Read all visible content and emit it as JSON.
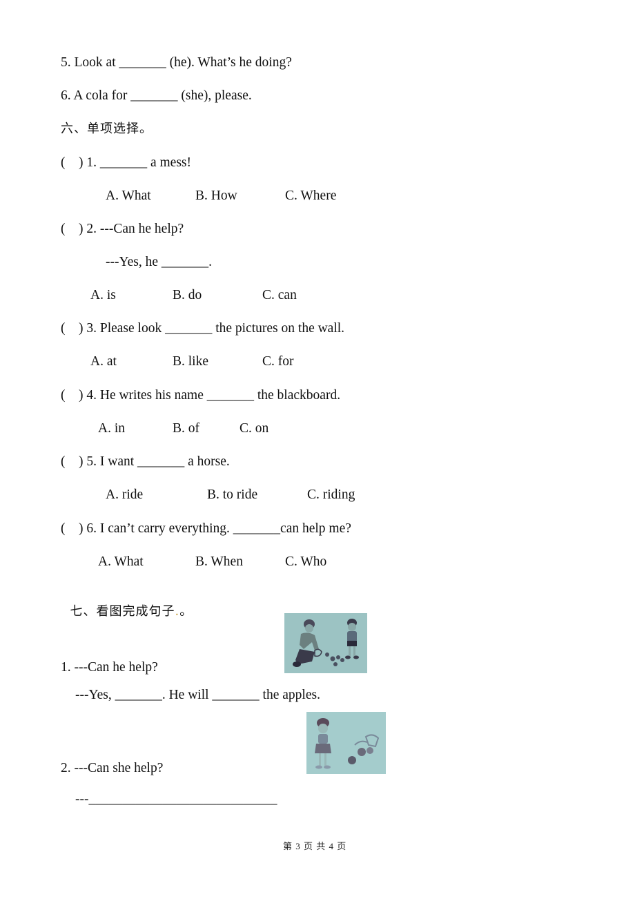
{
  "fill_in": [
    {
      "text": "5. Look at _______ (he). What’s he doing?"
    },
    {
      "text": "6. A cola for _______ (she), please."
    }
  ],
  "section6": {
    "heading": "六、单项选择。",
    "questions": [
      {
        "stem": "(    ) 1. _______ a mess!",
        "options": [
          "A. What",
          "B. How",
          "C. Where"
        ]
      },
      {
        "stem": "(    ) 2. ---Can he help?",
        "sub": "---Yes, he _______.",
        "options": [
          "A. is",
          "B. do",
          "C. can"
        ]
      },
      {
        "stem": "(    ) 3. Please look _______ the pictures on the wall.",
        "options": [
          "A. at",
          "B. like",
          "C. for"
        ]
      },
      {
        "stem": "(    ) 4. He writes his name _______ the blackboard.",
        "options": [
          "A. in",
          "B. of",
          "C. on"
        ]
      },
      {
        "stem": "(    ) 5. I want _______ a horse.",
        "options": [
          "A. ride",
          "B. to ride",
          "C. riding"
        ]
      },
      {
        "stem": "(    ) 6. I can’t carry everything. _______can help me?",
        "options": [
          "A. What",
          "B. When",
          "C. Who"
        ]
      }
    ]
  },
  "section7": {
    "heading": "七、看图完成句子",
    "heading_end": "。",
    "items": [
      {
        "question": "1. ---Can he help?",
        "answer": "---Yes, _______. He will _______ the apples.",
        "image": "picture-man-picking-apples-with-boy"
      },
      {
        "question": "2. ---Can she help?",
        "answer": "---____________________________",
        "image": "picture-girl-with-fallen-items"
      }
    ]
  },
  "footer": {
    "text": "第 3 页 共 4 页"
  }
}
